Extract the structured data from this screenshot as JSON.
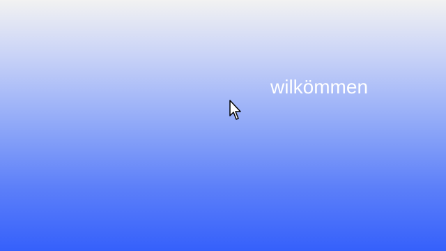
{
  "screen": {
    "welcome_text": "wilkömmen",
    "background_top_color": "#f2f2f2",
    "background_bottom_color": "#3560fb",
    "text_color": "#ffffff"
  },
  "cursor": {
    "icon": "arrow-cursor-icon"
  }
}
